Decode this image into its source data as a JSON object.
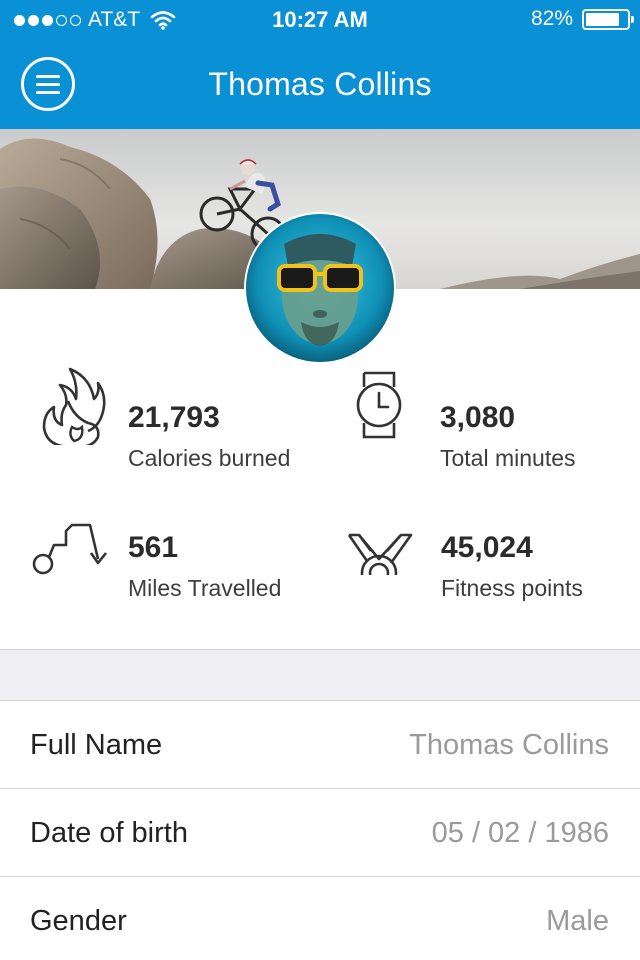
{
  "status_bar": {
    "carrier": "AT&T",
    "time": "10:27 AM",
    "battery_percent": "82%",
    "battery_level": 0.82,
    "signal_bars_filled": 3,
    "signal_bars_total": 5
  },
  "nav": {
    "title": "Thomas Collins",
    "menu_icon": "hamburger-menu-icon"
  },
  "colors": {
    "header_bg": "#0a90d4",
    "band_bg": "#efeff4"
  },
  "stats": [
    {
      "icon": "flame-icon",
      "value": "21,793",
      "label": "Calories burned"
    },
    {
      "icon": "watch-icon",
      "value": "3,080",
      "label": "Total minutes"
    },
    {
      "icon": "route-icon",
      "value": "561",
      "label": "Miles Travelled"
    },
    {
      "icon": "medal-icon",
      "value": "45,024",
      "label": "Fitness points"
    }
  ],
  "profile_fields": [
    {
      "label": "Full Name",
      "value": "Thomas Collins"
    },
    {
      "label": "Date of birth",
      "value": "05 / 02 / 1986"
    },
    {
      "label": "Gender",
      "value": "Male"
    }
  ]
}
